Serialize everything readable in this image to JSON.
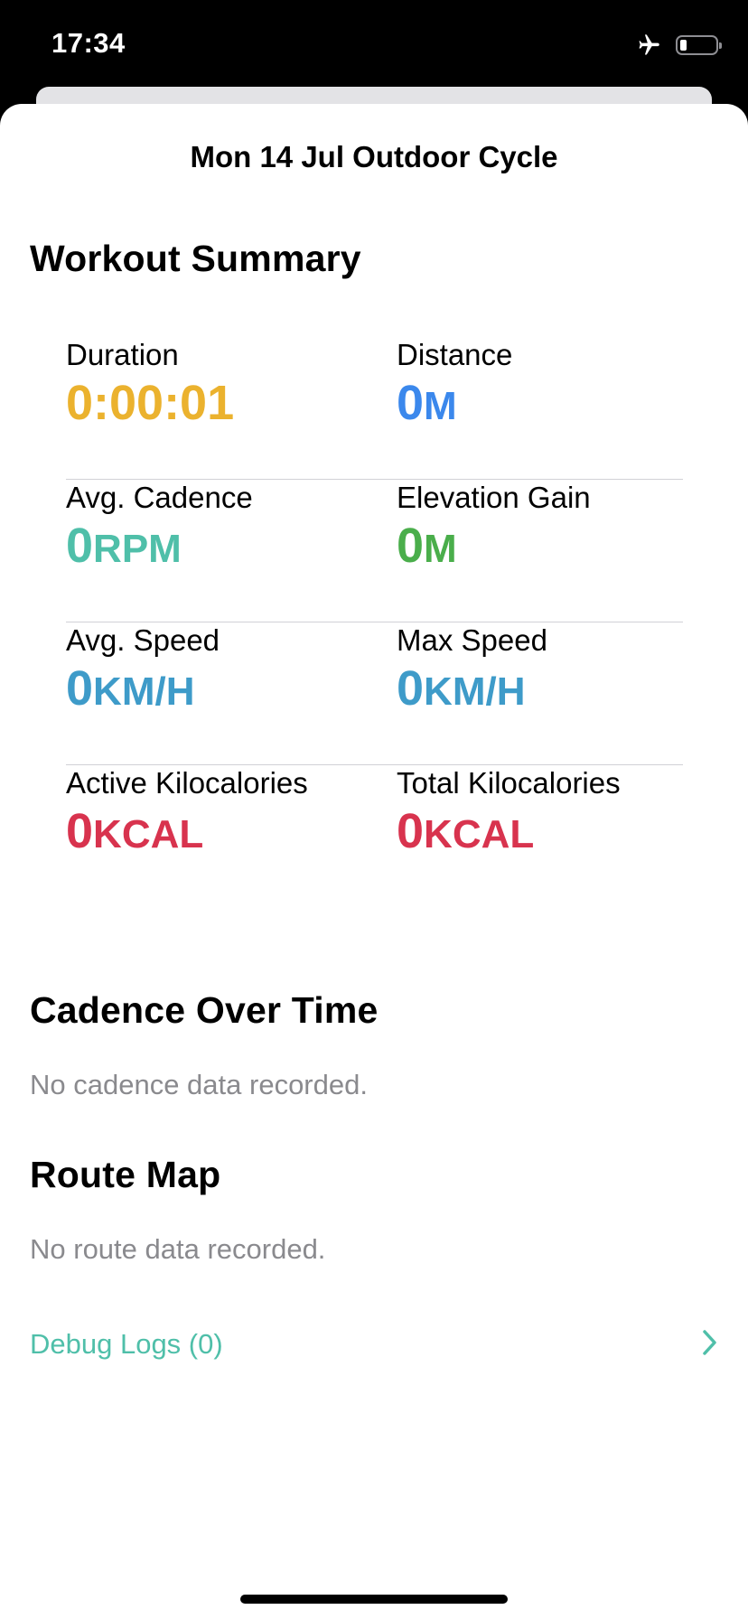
{
  "status_bar": {
    "time": "17:34",
    "battery_level": 0.2
  },
  "header": {
    "title": "Mon 14 Jul Outdoor Cycle"
  },
  "summary": {
    "heading": "Workout Summary",
    "metrics": [
      {
        "label": "Duration",
        "value": "0:00:01",
        "unit": "",
        "color": "#EBB22E"
      },
      {
        "label": "Distance",
        "value": "0",
        "unit": "M",
        "color": "#3B88EC"
      },
      {
        "label": "Avg. Cadence",
        "value": "0",
        "unit": "RPM",
        "color": "#4FBFA9"
      },
      {
        "label": "Elevation Gain",
        "value": "0",
        "unit": "M",
        "color": "#4AAE4B"
      },
      {
        "label": "Avg. Speed",
        "value": "0",
        "unit": "KM/H",
        "color": "#3E9BC9"
      },
      {
        "label": "Max Speed",
        "value": "0",
        "unit": "KM/H",
        "color": "#3E9BC9"
      },
      {
        "label": "Active Kilocalories",
        "value": "0",
        "unit": "KCAL",
        "color": "#D8334E"
      },
      {
        "label": "Total Kilocalories",
        "value": "0",
        "unit": "KCAL",
        "color": "#D8334E"
      }
    ]
  },
  "cadence": {
    "heading": "Cadence Over Time",
    "empty_text": "No cadence data recorded."
  },
  "route": {
    "heading": "Route Map",
    "empty_text": "No route data recorded."
  },
  "debug": {
    "label": "Debug Logs (0)",
    "accent": "#4FBFA9"
  },
  "icons": {
    "airplane": "airplane-icon",
    "battery": "battery-icon",
    "chevron": "chevron-right-icon"
  }
}
